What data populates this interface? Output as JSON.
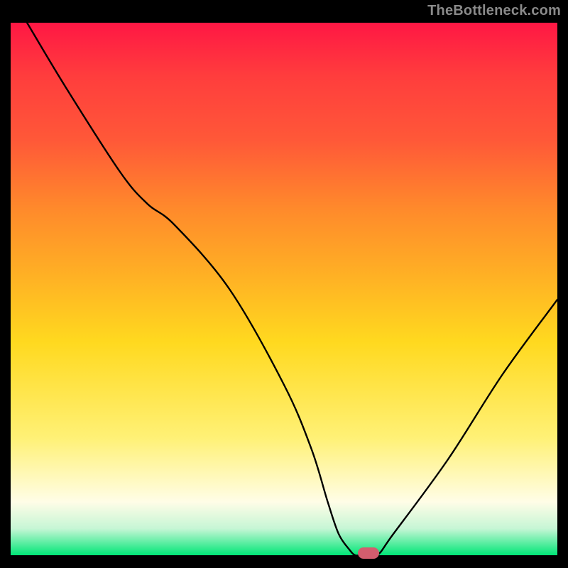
{
  "watermark": "TheBottleneck.com",
  "chart_data": {
    "type": "line",
    "title": "",
    "xlabel": "",
    "ylabel": "",
    "xlim": [
      0,
      100
    ],
    "ylim": [
      0,
      100
    ],
    "grid": false,
    "legend": false,
    "series": [
      {
        "name": "bottleneck-curve",
        "x": [
          3,
          10,
          20,
          25,
          30,
          40,
          50,
          55,
          58,
          60,
          62,
          63,
          64,
          67,
          70,
          80,
          90,
          100
        ],
        "y": [
          100,
          88,
          72,
          66,
          62,
          50,
          32,
          20,
          10,
          4,
          1,
          0,
          0,
          0,
          4,
          18,
          34,
          48
        ]
      }
    ],
    "marker": {
      "x": 65.5,
      "y": 0
    },
    "background_gradient": {
      "top": "#ff1744",
      "mid": "#ffd91f",
      "bottom": "#00e676"
    }
  }
}
